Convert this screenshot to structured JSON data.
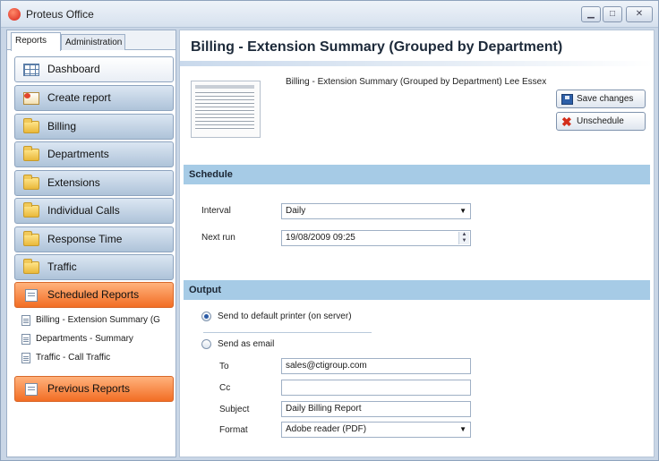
{
  "window": {
    "title": "Proteus Office"
  },
  "tabs": [
    {
      "label": "Reports",
      "active": true
    },
    {
      "label": "Administration",
      "active": false
    }
  ],
  "nav": [
    {
      "label": "Dashboard",
      "icon": "grid-icon",
      "style": "light"
    },
    {
      "label": "Create report",
      "icon": "create-report-icon",
      "style": "blue"
    },
    {
      "label": "Billing",
      "icon": "folder-icon",
      "style": "blue"
    },
    {
      "label": "Departments",
      "icon": "folder-icon",
      "style": "blue"
    },
    {
      "label": "Extensions",
      "icon": "folder-icon",
      "style": "blue"
    },
    {
      "label": "Individual Calls",
      "icon": "folder-icon",
      "style": "blue"
    },
    {
      "label": "Response Time",
      "icon": "folder-icon",
      "style": "blue"
    },
    {
      "label": "Traffic",
      "icon": "folder-icon",
      "style": "blue"
    },
    {
      "label": "Scheduled Reports",
      "icon": "document-icon",
      "style": "orange"
    }
  ],
  "scheduled": [
    "Billing - Extension Summary (G",
    "Departments - Summary",
    "Traffic - Call Traffic"
  ],
  "previous_reports": {
    "label": "Previous Reports",
    "icon": "document-icon"
  },
  "main": {
    "title": "Billing - Extension Summary (Grouped by Department)",
    "caption": "Billing - Extension Summary (Grouped by Department) Lee Essex",
    "save_label": "Save changes",
    "unschedule_label": "Unschedule"
  },
  "schedule": {
    "header": "Schedule",
    "interval_label": "Interval",
    "interval_value": "Daily",
    "next_run_label": "Next run",
    "next_run_value": "19/08/2009 09:25"
  },
  "output": {
    "header": "Output",
    "printer_option": "Send to default printer (on server)",
    "email_option": "Send as email",
    "selected": "printer",
    "to_label": "To",
    "to_value": "sales@ctigroup.com",
    "cc_label": "Cc",
    "cc_value": "",
    "subject_label": "Subject",
    "subject_value": "Daily Billing Report",
    "format_label": "Format",
    "format_value": "Adobe reader (PDF)"
  },
  "colors": {
    "section_header": "#a6cbe6",
    "nav_blue": "#aec3d9",
    "nav_orange": "#f26d24"
  }
}
